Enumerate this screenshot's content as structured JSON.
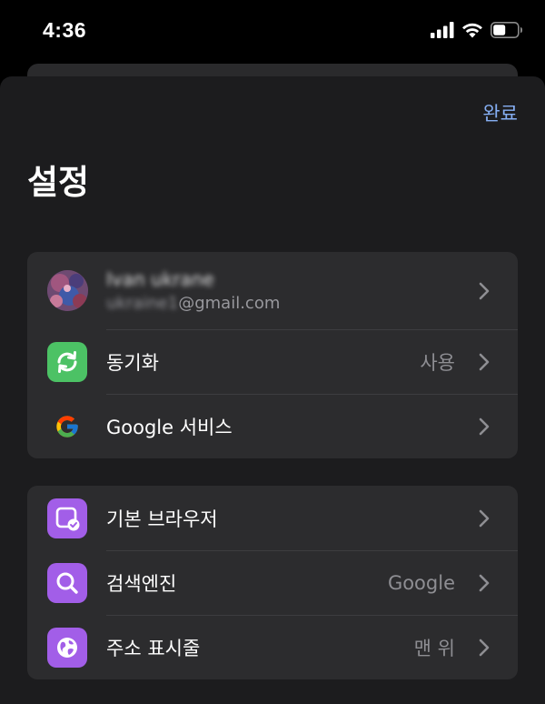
{
  "status_bar": {
    "time": "4:36",
    "icons": [
      "signal-icon",
      "wifi-icon",
      "battery-icon"
    ]
  },
  "sheet": {
    "done_label": "완료",
    "title": "설정"
  },
  "colors": {
    "accent": "#86aff4",
    "sync_icon_bg": "#4cc265",
    "purple_icon_bg": "#a25ee8",
    "group_bg": "#2c2c2e",
    "sheet_bg": "#1c1c1e",
    "secondary_text": "#8e8e93"
  },
  "account": {
    "name": "Ivan ukrane",
    "email_local": "ukraine1",
    "email_domain": "@gmail.com"
  },
  "group1": {
    "sync": {
      "label": "동기화",
      "value": "사용",
      "icon": "sync-icon"
    },
    "google_services": {
      "label": "Google 서비스",
      "icon": "google-icon"
    }
  },
  "group2": {
    "default_browser": {
      "label": "기본 브라우저",
      "icon": "default-browser-icon"
    },
    "search_engine": {
      "label": "검색엔진",
      "value": "Google",
      "icon": "search-icon"
    },
    "address_bar": {
      "label": "주소 표시줄",
      "value": "맨 위",
      "icon": "globe-icon"
    }
  }
}
